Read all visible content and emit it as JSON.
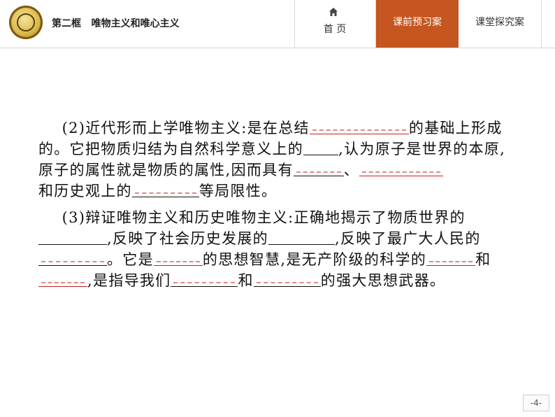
{
  "header": {
    "section_title": "第二框   唯物主义和唯心主义",
    "logo_icon": "school-seal-icon",
    "home_icon": "house-icon",
    "home_label": "首  页",
    "tab_preview": "课前预习案",
    "tab_explore": "课堂探究案",
    "active_tab_color": "#c5561f"
  },
  "content": {
    "p2": {
      "a": "(2)近代形而上学唯物主义:是在总结",
      "b": "的基础上形成的。它把物质归结为自然科学意义上的",
      "c": ",认为原子是世界的本原,原子的属性就是物质的属性,因而具有",
      "d": "、",
      "e": "和历史观上的",
      "f": "等局限性。"
    },
    "p3": {
      "a": "(3)辩证唯物主义和历史唯物主义:正确地揭示了物质世界的",
      "b": ",反映了社会历史发展的",
      "c": ",反映了最广大人民的",
      "d": "。它是",
      "e": "的思想智慧,是无产阶级的科学的",
      "f": "和",
      "g": ",是指导我们",
      "h": "和",
      "i": "的强大思想武器。"
    }
  },
  "footer": {
    "page_number": "-4-"
  }
}
